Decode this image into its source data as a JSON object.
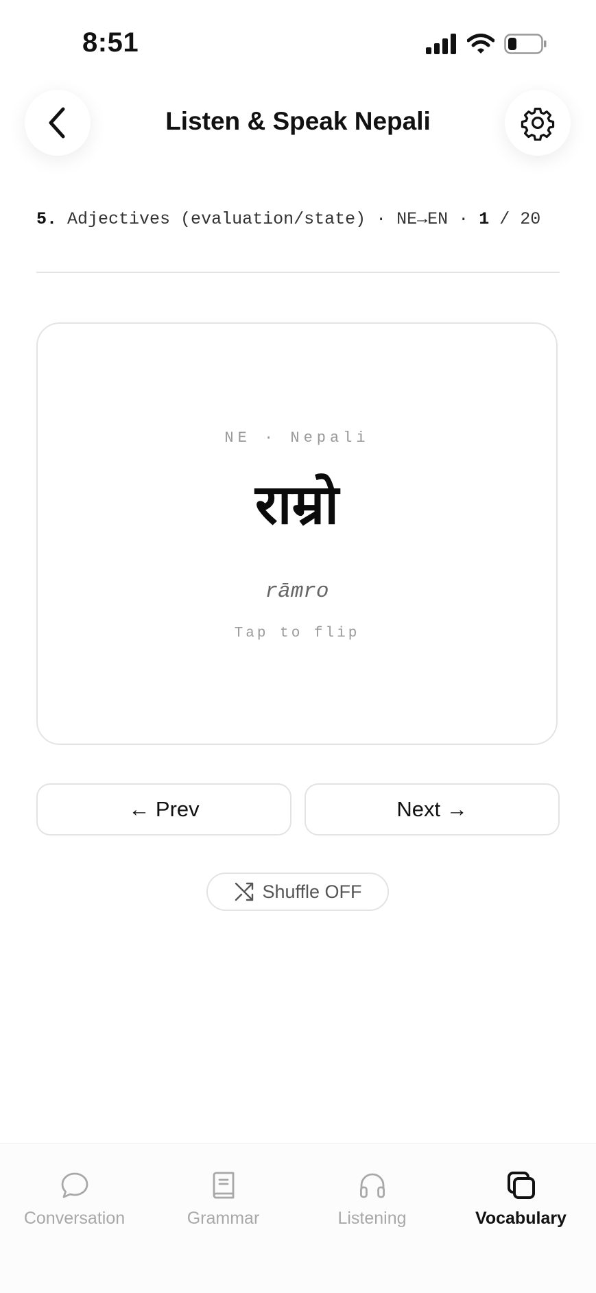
{
  "status_bar": {
    "time": "8:51"
  },
  "header": {
    "title": "Listen & Speak Nepali",
    "back_icon": "chevron-left-icon",
    "settings_icon": "gear-icon"
  },
  "meta": {
    "section_number": "5.",
    "section_name": "Adjectives (evaluation/state)",
    "separator": "·",
    "direction": "NE→EN",
    "current": "1",
    "total_text": "/ 20"
  },
  "card": {
    "language_label": "NE · Nepali",
    "word": "राम्रो",
    "transliteration": "rāmro",
    "hint": "Tap to flip"
  },
  "controls": {
    "prev_label": "← Prev",
    "next_label": "Next →",
    "shuffle_label": "Shuffle OFF"
  },
  "tabs": [
    {
      "label": "Conversation",
      "icon": "chat-bubble-icon",
      "active": false
    },
    {
      "label": "Grammar",
      "icon": "book-icon",
      "active": false
    },
    {
      "label": "Listening",
      "icon": "headphones-icon",
      "active": false
    },
    {
      "label": "Vocabulary",
      "icon": "cards-icon",
      "active": true
    }
  ],
  "colors": {
    "active": "#111111",
    "inactive": "#a8a8a8",
    "border": "#e3e3e3"
  }
}
